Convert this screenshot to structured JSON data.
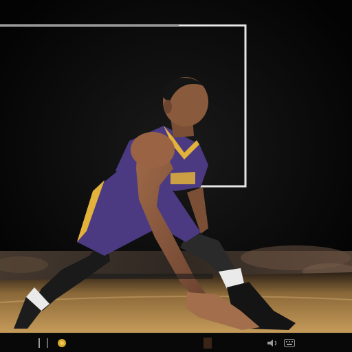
{
  "image": {
    "subject": "basketball-player-dribbling",
    "setting": "indoor-arena-court",
    "colors": {
      "background": "#050505",
      "jersey": "#4b3a82",
      "jersey_trim": "#e2b23a",
      "skin": "#8a5a3d",
      "court": "#b58a4e",
      "box_outline": "#e6e6e6",
      "accent_dot": "#d8a62a"
    }
  },
  "controls": {
    "icons": [
      "bar-icon",
      "play-dot-icon",
      "volume-icon",
      "keyboard-icon"
    ]
  }
}
